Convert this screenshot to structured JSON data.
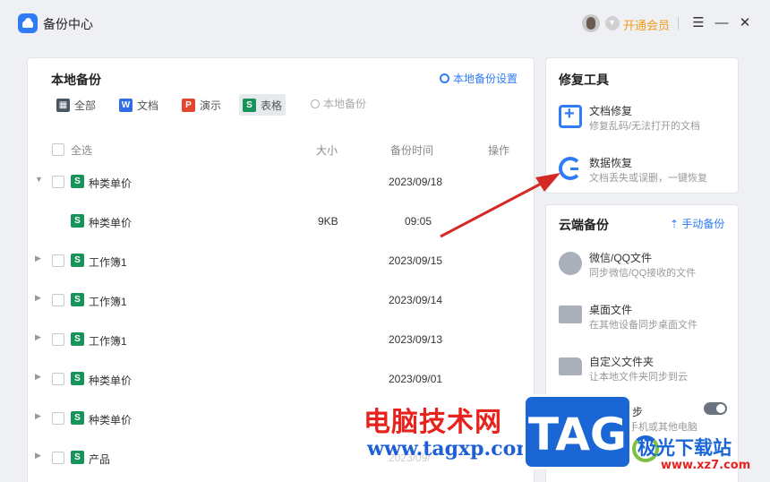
{
  "titlebar": {
    "app_title": "备份中心",
    "vip_label": "开通会员",
    "menu_icon": "menu-icon",
    "minimize_icon": "minimize-icon",
    "close_icon": "close-icon"
  },
  "local_backup": {
    "title": "本地备份",
    "settings_label": "本地备份设置",
    "filters": [
      {
        "label": "全部",
        "glyph": "▦"
      },
      {
        "label": "文档",
        "glyph": "W"
      },
      {
        "label": "演示",
        "glyph": "P"
      },
      {
        "label": "表格",
        "glyph": "S"
      }
    ],
    "search_placeholder": "本地备份",
    "columns": {
      "select_all": "全选",
      "size": "大小",
      "time": "备份时间",
      "action": "操作"
    },
    "rows": [
      {
        "name": "种类单价",
        "size": "",
        "time": "2023/09/18",
        "arrow": "▼",
        "child": false
      },
      {
        "name": "种类单价",
        "size": "9KB",
        "time": "09:05",
        "arrow": "",
        "child": true
      },
      {
        "name": "工作簿1",
        "size": "",
        "time": "2023/09/15",
        "arrow": "▶",
        "child": false
      },
      {
        "name": "工作簿1",
        "size": "",
        "time": "2023/09/14",
        "arrow": "▶",
        "child": false
      },
      {
        "name": "工作簿1",
        "size": "",
        "time": "2023/09/13",
        "arrow": "▶",
        "child": false
      },
      {
        "name": "种类单价",
        "size": "",
        "time": "2023/09/01",
        "arrow": "▶",
        "child": false
      },
      {
        "name": "种类单价",
        "size": "",
        "time": "",
        "arrow": "▶",
        "child": false
      },
      {
        "name": "产品",
        "size": "",
        "time": "2023/09/",
        "arrow": "▶",
        "child": false
      }
    ]
  },
  "repair_tools": {
    "title": "修复工具",
    "items": [
      {
        "name": "文档修复",
        "desc": "修复乱码/无法打开的文档"
      },
      {
        "name": "数据恢复",
        "desc": "文档丢失或误删，一键恢复"
      }
    ]
  },
  "cloud_backup": {
    "title": "云端备份",
    "manual_label": "手动备份",
    "items": [
      {
        "name": "微信/QQ文件",
        "desc": "同步微信/QQ接收的文件"
      },
      {
        "name": "桌面文件",
        "desc": "在其他设备同步桌面文件"
      },
      {
        "name": "自定义文件夹",
        "desc": "让本地文件夹同步到云"
      },
      {
        "name": "文档云同步",
        "desc": "在自己的手机或其他电脑"
      }
    ],
    "toggle_state": "on"
  },
  "watermark": {
    "cn_text": "电脑技术网",
    "url_text": "www.tagxp.com",
    "tag_text": "TAG",
    "site_text": "极光下载站",
    "site_url": "www.xz7.com"
  },
  "colors": {
    "accent": "#2f7cf6",
    "vip": "#f39b1b",
    "sheet": "#18945a",
    "arrow": "#d42a26"
  }
}
